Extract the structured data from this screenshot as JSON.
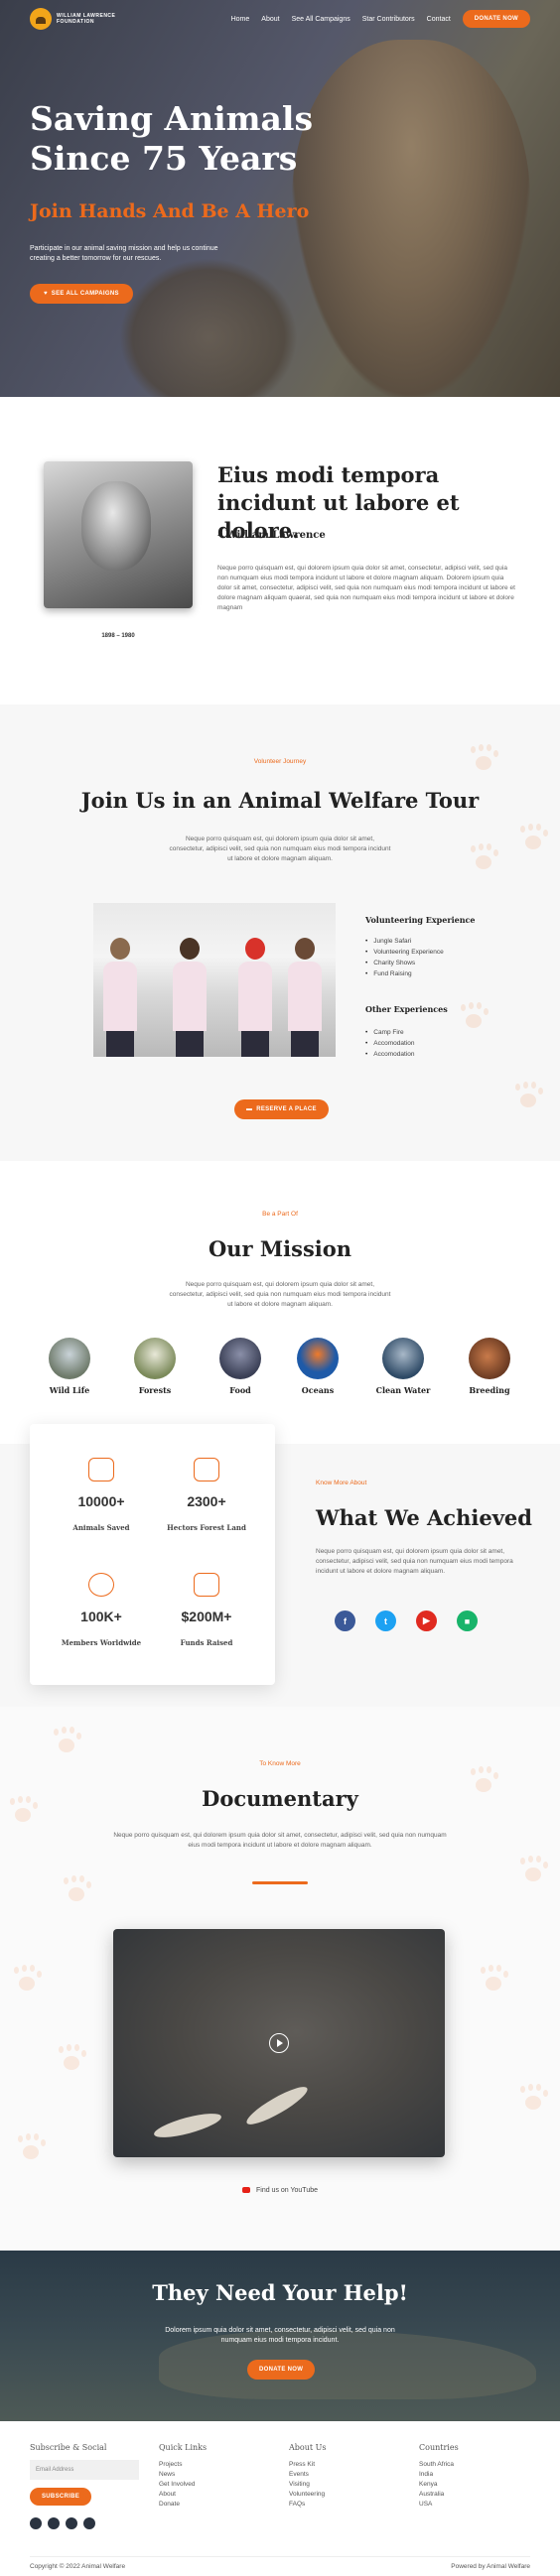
{
  "nav": {
    "logo_line1": "WILLIAM LAWRENCE",
    "logo_line2": "FOUNDATION",
    "links": [
      "Home",
      "About",
      "See All Campaigns",
      "Star Contributors",
      "Contact"
    ],
    "donate": "DONATE NOW"
  },
  "hero": {
    "title_line1": "Saving Animals",
    "title_line2": "Since 75 Years",
    "subtitle": "Join Hands And Be A Hero",
    "text": "Participate in our animal saving mission and help us continue creating a better tomorrow for our rescues.",
    "cta": "SEE ALL CAMPAIGNS"
  },
  "founder": {
    "quote": "Eius modi tempora incidunt ut labore et dolore.",
    "author": "– William Lawrence",
    "bio": "Neque porro quisquam est, qui dolorem ipsum quia dolor sit amet, consectetur, adipisci velit, sed quia non numquam eius modi tempora incidunt ut labore et dolore magnam aliquam. Dolorem ipsum quia dolor sit amet, consectetur, adipisci velit, sed quia non numquam eius modi tempora incidunt ut labore et dolore magnam aliquam quaerat, sed quia non numquam eius modi tempora incidunt ut labore et dolore magnam",
    "dates": "1898 – 1980"
  },
  "tour": {
    "eyebrow": "Volunteer Journey",
    "title": "Join Us in an Animal Welfare Tour",
    "text": "Neque porro quisquam est, qui dolorem ipsum quia dolor sit amet, consectetur, adipisci velit, sed quia non numquam eius modi tempora incidunt ut labore et dolore magnam aliquam.",
    "volunteering_title": "Volunteering Experience",
    "volunteering_items": [
      "Jungle Safari",
      "Volunteering Experience",
      "Charity Shows",
      "Fund Raising"
    ],
    "other_title": "Other Experiences",
    "other_items": [
      "Camp Fire",
      "Accomodation",
      "Accomodation"
    ],
    "cta": "RESERVE A PLACE"
  },
  "mission": {
    "eyebrow": "Be a Part Of",
    "title": "Our Mission",
    "text": "Neque porro quisquam est, qui dolorem ipsum quia dolor sit amet, consectetur, adipisci velit, sed quia non numquam eius modi tempora incidunt ut labore et dolore magnam aliquam.",
    "categories": [
      "Wild Life",
      "Forests",
      "Food",
      "Oceans",
      "Clean Water",
      "Breeding"
    ]
  },
  "achieved": {
    "stats": [
      {
        "number": "10000+",
        "label": "Animals Saved"
      },
      {
        "number": "2300+",
        "label": "Hectors Forest Land"
      },
      {
        "number": "100K+",
        "label": "Members Worldwide"
      },
      {
        "number": "$200M+",
        "label": "Funds Raised"
      }
    ],
    "eyebrow": "Know More About",
    "title": "What We Achieved",
    "text": "Neque porro quisquam est, qui dolorem ipsum quia dolor sit amet, consectetur, adipisci velit, sed quia non numquam eius modi tempora incidunt ut labore et dolore magnam aliquam."
  },
  "documentary": {
    "eyebrow": "To Know More",
    "title": "Documentary",
    "text": "Neque porro quisquam est, qui dolorem ipsum quia dolor sit amet, consectetur, adipisci velit, sed quia non numquam eius modi tempora incidunt ut labore et dolore magnam aliquam.",
    "youtube": "Find us on YouTube"
  },
  "help": {
    "title": "They Need Your Help!",
    "text": "Dolorem ipsum quia dolor sit amet, consectetur, adipisci velit, sed quia non numquam eius modi tempora incidunt.",
    "cta": "DONATE NOW"
  },
  "footer": {
    "subscribe_title": "Subscribe & Social",
    "email_placeholder": "Email Address",
    "subscribe_btn": "SUBSCRIBE",
    "quick_title": "Quick Links",
    "quick_items": [
      "Projects",
      "News",
      "Get Involved",
      "About",
      "Donate"
    ],
    "about_title": "About Us",
    "about_items": [
      "Press Kit",
      "Events",
      "Visiting",
      "Volunteering",
      "FAQs"
    ],
    "countries_title": "Countries",
    "countries_items": [
      "South Africa",
      "India",
      "Kenya",
      "Australia",
      "USA"
    ],
    "copyright": "Copyright © 2022 Animal Welfare",
    "powered": "Powered by Animal Welfare"
  },
  "colors": {
    "accent": "#ec6a1c",
    "dark": "#222222",
    "section_bg": "#f7f7f7"
  }
}
